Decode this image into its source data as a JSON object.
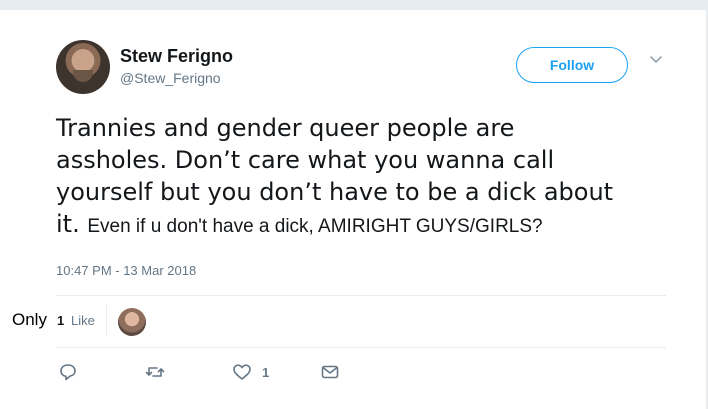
{
  "user": {
    "display_name": "Stew Ferigno",
    "screen_name": "@Stew_Ferigno"
  },
  "follow_button": {
    "label": "Follow"
  },
  "tweet": {
    "text_lines": [
      "Trannies and gender queer people are",
      "assholes. Don’t care what you wanna call",
      "yourself but you don’t have to be a dick about"
    ],
    "text_last_prefix": "it. ",
    "text_added": "Even if u don't have a dick, AMIRIGHT GUYS/GIRLS?",
    "timestamp": "10:47 PM - 13 Mar 2018"
  },
  "stats": {
    "prefix": "Only",
    "likes_count": "1",
    "likes_label": "Like"
  },
  "actions": {
    "like_count": "1"
  },
  "colors": {
    "accent": "#1da1f2",
    "text": "#14171a",
    "secondary": "#657786",
    "border": "#e6ecf0"
  }
}
